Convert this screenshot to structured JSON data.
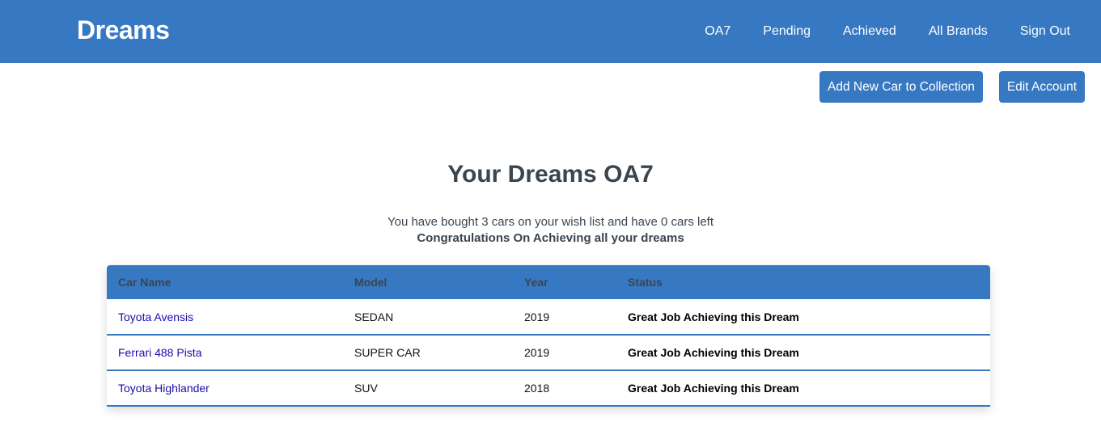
{
  "navbar": {
    "brand": "Dreams",
    "links": [
      {
        "label": "OA7"
      },
      {
        "label": "Pending"
      },
      {
        "label": "Achieved"
      },
      {
        "label": "All Brands"
      },
      {
        "label": "Sign Out"
      }
    ],
    "color": "#3778c2"
  },
  "actions": {
    "add_car_label": "Add New Car to Collection",
    "edit_account_label": "Edit Account"
  },
  "main": {
    "title": "Your Dreams OA7",
    "summary": "You have bought 3 cars on your wish list and have 0 cars left",
    "congrats": "Congratulations On Achieving all your dreams"
  },
  "table": {
    "headers": [
      "Car Name",
      "Model",
      "Year",
      "Status"
    ],
    "rows": [
      {
        "name": "Toyota Avensis",
        "model": "SEDAN",
        "year": "2019",
        "status": "Great Job Achieving this Dream"
      },
      {
        "name": "Ferrari 488 Pista",
        "model": "SUPER CAR",
        "year": "2019",
        "status": "Great Job Achieving this Dream"
      },
      {
        "name": "Toyota Highlander",
        "model": "SUV",
        "year": "2018",
        "status": "Great Job Achieving this Dream"
      }
    ]
  }
}
